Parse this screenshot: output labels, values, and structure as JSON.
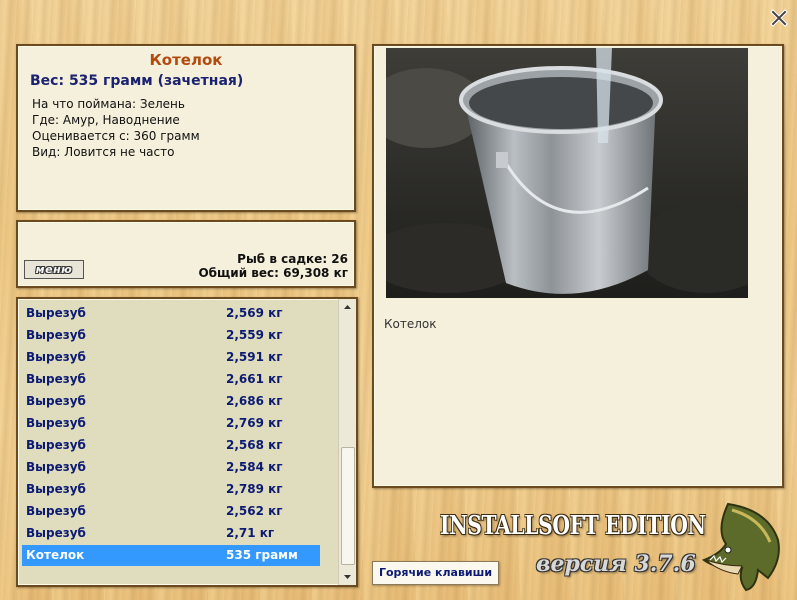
{
  "window": {
    "close_icon": "close-x-icon"
  },
  "fish": {
    "name": "Котелок",
    "weight": "Вес: 535 грамм (зачетная)",
    "caught_on": "На что поймана: Зелень",
    "where": "Где: Амур, Наводнение",
    "valued_from": "Оценивается с: 360 грамм",
    "kind": "Вид: Ловится не часто"
  },
  "stats": {
    "menu_label": "меню",
    "fish_count": "Рыб в садке: 26",
    "total_weight": "Общий вес: 69,308 кг"
  },
  "catch_list": [
    {
      "name": "Вырезуб",
      "weight": "2,569 кг"
    },
    {
      "name": "Вырезуб",
      "weight": "2,559 кг"
    },
    {
      "name": "Вырезуб",
      "weight": "2,591 кг"
    },
    {
      "name": "Вырезуб",
      "weight": "2,661 кг"
    },
    {
      "name": "Вырезуб",
      "weight": "2,686 кг"
    },
    {
      "name": "Вырезуб",
      "weight": "2,769 кг"
    },
    {
      "name": "Вырезуб",
      "weight": "2,568 кг"
    },
    {
      "name": "Вырезуб",
      "weight": "2,584 кг"
    },
    {
      "name": "Вырезуб",
      "weight": "2,789 кг"
    },
    {
      "name": "Вырезуб",
      "weight": "2,562 кг"
    },
    {
      "name": "Вырезуб",
      "weight": "2,71 кг"
    },
    {
      "name": "Котелок",
      "weight": "535 грамм",
      "selected": true
    }
  ],
  "photo": {
    "caption": "Котелок",
    "subject": "metal-pot-photo"
  },
  "buttons": {
    "hotkeys": "Горячие клавиши"
  },
  "branding": {
    "edition": "INSTALLSOFT EDITION",
    "version": "версия 3.7.6",
    "logo": "pike-fish-logo"
  },
  "colors": {
    "title_orange": "#b24a0e",
    "text_navy": "#1b2270",
    "list_bg": "#e0ddbf",
    "selection": "#3399ff",
    "panel_bg": "#f5f0dc"
  }
}
